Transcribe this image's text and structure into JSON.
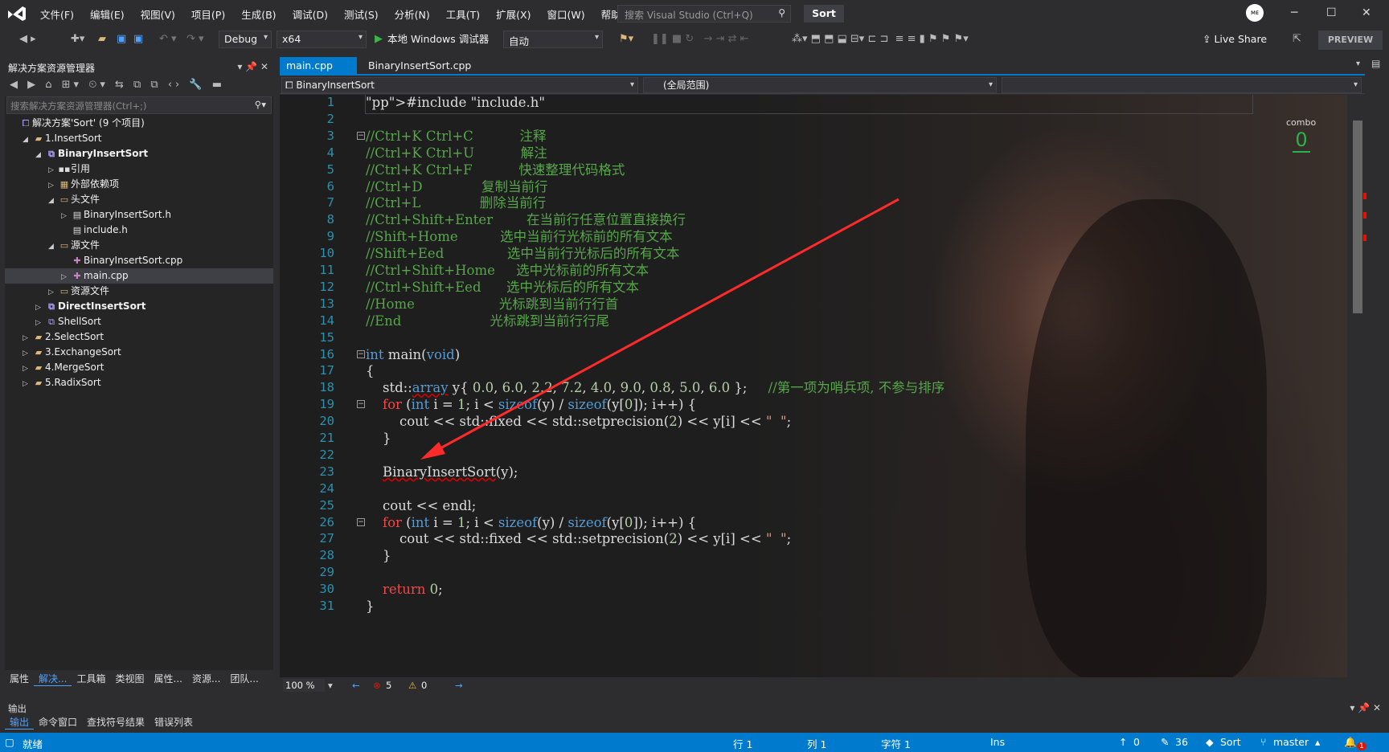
{
  "menu": [
    "文件(F)",
    "编辑(E)",
    "视图(V)",
    "项目(P)",
    "生成(B)",
    "调试(D)",
    "测试(S)",
    "分析(N)",
    "工具(T)",
    "扩展(X)",
    "窗口(W)",
    "帮助(H)"
  ],
  "search_placeholder": "搜索 Visual Studio (Ctrl+Q)",
  "project_name": "Sort",
  "avatar_text": "ᴍᴇ",
  "toolbar": {
    "config": "Debug",
    "platform": "x64",
    "run_label": "本地 Windows 调试器",
    "run_mode": "自动",
    "live_share": "Live Share",
    "preview": "PREVIEW"
  },
  "solution_explorer": {
    "title": "解决方案资源管理器",
    "search_placeholder": "搜索解决方案资源管理器(Ctrl+;)",
    "items": [
      {
        "label": "解决方案'Sort' (9 个项目)",
        "depth": 0,
        "arrow": "",
        "icon": "solution-icon"
      },
      {
        "label": "1.InsertSort",
        "depth": 1,
        "arrow": "◢",
        "icon": "folder-icon"
      },
      {
        "label": "BinaryInsertSort",
        "depth": 2,
        "arrow": "◢",
        "icon": "project-icon",
        "bold": true
      },
      {
        "label": "引用",
        "depth": 3,
        "arrow": "▷",
        "icon": "references-icon"
      },
      {
        "label": "外部依赖项",
        "depth": 3,
        "arrow": "▷",
        "icon": "external-deps-icon"
      },
      {
        "label": "头文件",
        "depth": 3,
        "arrow": "◢",
        "icon": "filter-folder-icon"
      },
      {
        "label": "BinaryInsertSort.h",
        "depth": 4,
        "arrow": "▷",
        "icon": "header-file-icon"
      },
      {
        "label": "include.h",
        "depth": 4,
        "arrow": "",
        "icon": "header-file-icon"
      },
      {
        "label": "源文件",
        "depth": 3,
        "arrow": "◢",
        "icon": "filter-folder-icon"
      },
      {
        "label": "BinaryInsertSort.cpp",
        "depth": 4,
        "arrow": "",
        "icon": "cpp-file-icon"
      },
      {
        "label": "main.cpp",
        "depth": 4,
        "arrow": "▷",
        "icon": "cpp-file-icon",
        "selected": true
      },
      {
        "label": "资源文件",
        "depth": 3,
        "arrow": "▷",
        "icon": "filter-folder-icon"
      },
      {
        "label": "DirectInsertSort",
        "depth": 2,
        "arrow": "▷",
        "icon": "project-icon",
        "bold": true
      },
      {
        "label": "ShellSort",
        "depth": 2,
        "arrow": "▷",
        "icon": "project-icon"
      },
      {
        "label": "2.SelectSort",
        "depth": 1,
        "arrow": "▷",
        "icon": "folder-icon"
      },
      {
        "label": "3.ExchangeSort",
        "depth": 1,
        "arrow": "▷",
        "icon": "folder-icon"
      },
      {
        "label": "4.MergeSort",
        "depth": 1,
        "arrow": "▷",
        "icon": "folder-icon"
      },
      {
        "label": "5.RadixSort",
        "depth": 1,
        "arrow": "▷",
        "icon": "folder-icon"
      }
    ],
    "bottom_tabs": [
      "属性",
      "解决...",
      "工具箱",
      "类视图",
      "属性...",
      "资源...",
      "团队..."
    ]
  },
  "editor": {
    "tabs": [
      "main.cpp",
      "BinaryInsertSort.cpp"
    ],
    "nav_project": "BinaryInsertSort",
    "nav_scope": "(全局范围)",
    "combo_label": "combo",
    "combo_value": "0",
    "lines": [
      "#include \"include.h\"",
      "",
      "//Ctrl+K Ctrl+C           注释",
      "//Ctrl+K Ctrl+U           解注",
      "//Ctrl+K Ctrl+F           快速整理代码格式",
      "//Ctrl+D              复制当前行",
      "//Ctrl+L              删除当前行",
      "//Ctrl+Shift+Enter        在当前行任意位置直接换行",
      "//Shift+Home          选中当前行光标前的所有文本",
      "//Shift+Eed               选中当前行光标后的所有文本",
      "//Ctrl+Shift+Home     选中光标前的所有文本",
      "//Ctrl+Shift+Eed      选中光标后的所有文本",
      "//Home                    光标跳到当前行行首",
      "//End                     光标跳到当前行行尾",
      "",
      "int main(void)",
      "{",
      "    std::array y{ 0.0, 6.0, 2.2, 7.2, 4.0, 9.0, 0.8, 5.0, 6.0 };     //第一项为哨兵项, 不参与排序",
      "    for (int i = 1; i < sizeof(y) / sizeof(y[0]); i++) {",
      "        cout << std::fixed << std::setprecision(2) << y[i] << \"  \";",
      "    }",
      "",
      "    BinaryInsertSort(y);",
      "",
      "    cout << endl;",
      "    for (int i = 1; i < sizeof(y) / sizeof(y[0]); i++) {",
      "        cout << std::fixed << std::setprecision(2) << y[i] << \"  \";",
      "    }",
      "",
      "    return 0;",
      "}"
    ],
    "status": {
      "zoom": "100 %",
      "errors": "5",
      "warnings": "0"
    }
  },
  "output_panel": {
    "title": "输出",
    "tabs": [
      "输出",
      "命令窗口",
      "查找符号结果",
      "错误列表"
    ]
  },
  "statusbar": {
    "ready": "就绪",
    "line": "行 1",
    "col": "列 1",
    "char": "字符 1",
    "ins": "Ins",
    "up": "0",
    "edits": "36",
    "repo": "Sort",
    "branch": "master",
    "notif": "1"
  }
}
